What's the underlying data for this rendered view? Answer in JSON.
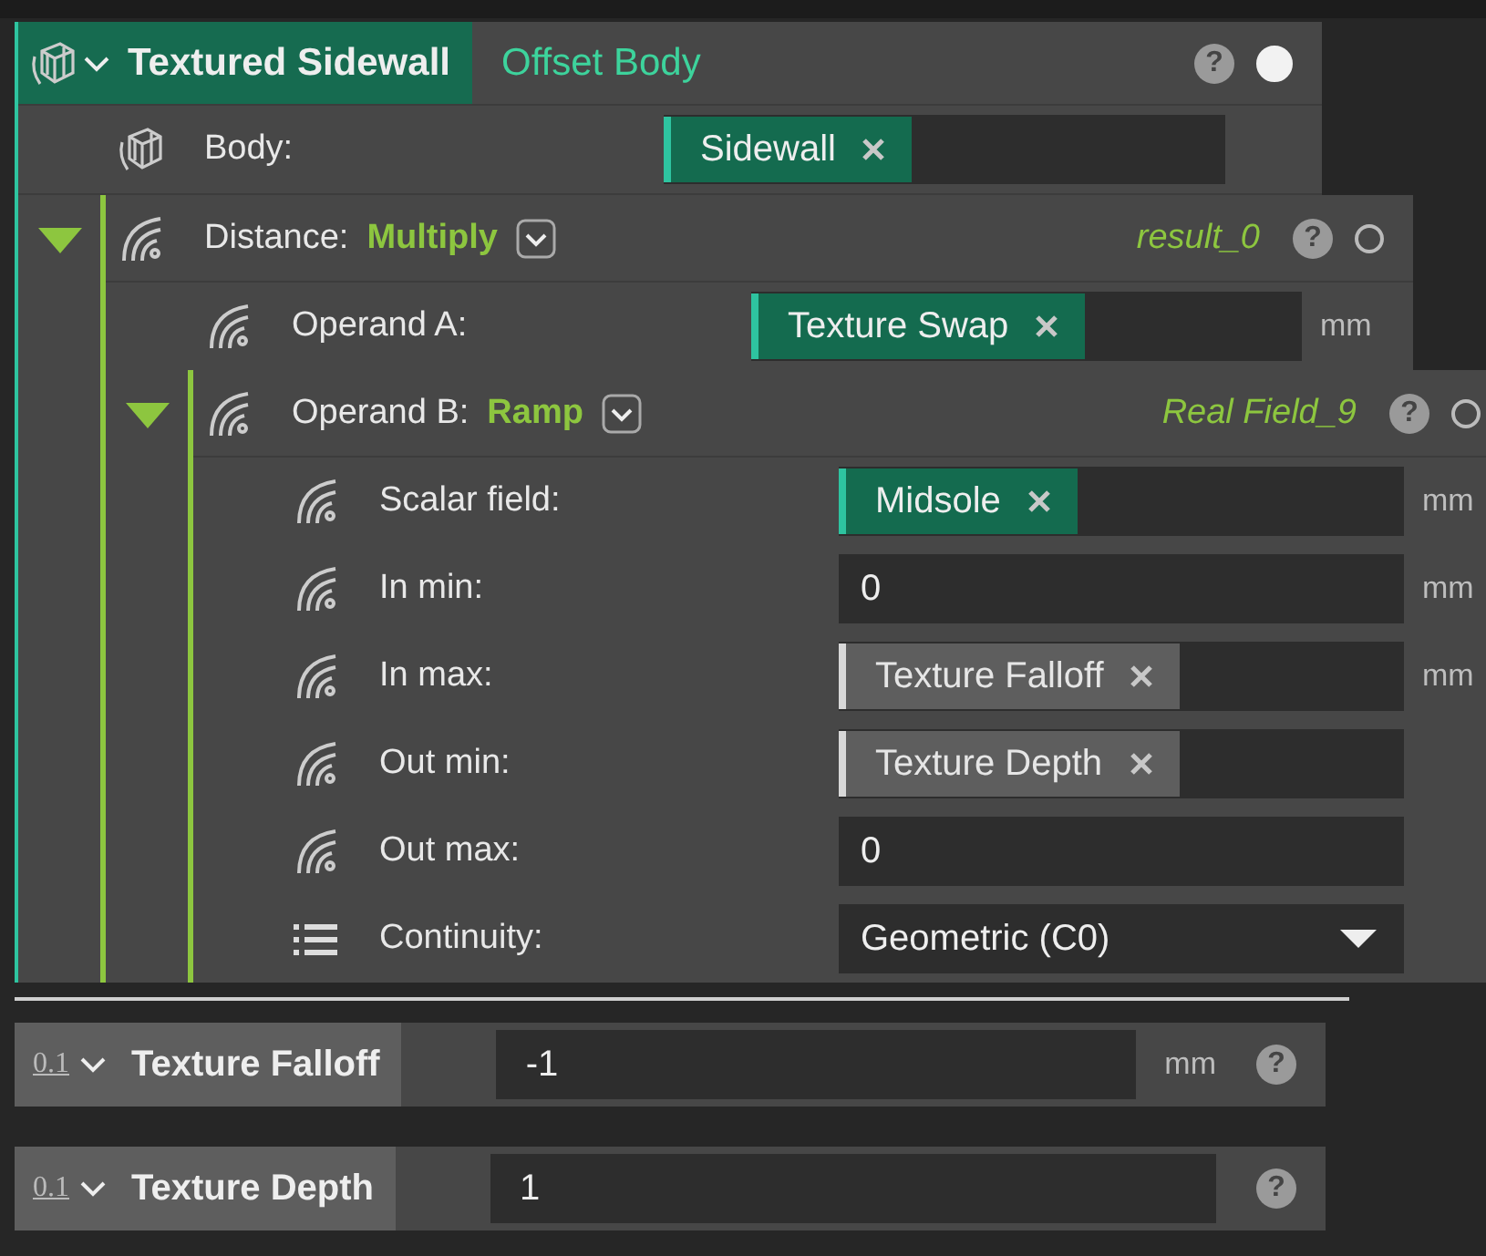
{
  "node": {
    "title": "Textured Sidewall",
    "type": "Offset Body",
    "help": "?",
    "exposed": true,
    "inputs": [
      {
        "label": "Body:",
        "kind": "chip",
        "chip": {
          "text": "Sidewall",
          "kind": "object"
        }
      }
    ]
  },
  "distance": {
    "label": "Distance:",
    "operator": "Multiply",
    "result": "result_0",
    "help": "?",
    "exposed": false,
    "expanded": true,
    "inputs": [
      {
        "label": "Operand A:",
        "kind": "chip",
        "chip": {
          "text": "Texture Swap",
          "kind": "object"
        },
        "unit": "mm"
      }
    ],
    "operand_b": {
      "label": "Operand B:",
      "operator": "Ramp",
      "result": "Real Field_9",
      "help": "?",
      "exposed": false,
      "expanded": true,
      "inputs": [
        {
          "label": "Scalar field:",
          "kind": "chip",
          "chip": {
            "text": "Midsole",
            "kind": "object"
          },
          "unit": "mm"
        },
        {
          "label": "In min:",
          "kind": "number",
          "value": "0",
          "unit": "mm"
        },
        {
          "label": "In max:",
          "kind": "chip",
          "chip": {
            "text": "Texture Falloff",
            "kind": "variable"
          },
          "unit": "mm"
        },
        {
          "label": "Out min:",
          "kind": "chip",
          "chip": {
            "text": "Texture Depth",
            "kind": "variable"
          }
        },
        {
          "label": "Out max:",
          "kind": "number",
          "value": "0"
        },
        {
          "label": "Continuity:",
          "kind": "dropdown",
          "value": "Geometric (C0)"
        }
      ]
    }
  },
  "parameters": [
    {
      "type_icon": "0.1",
      "label": "Texture Falloff",
      "value": "-1",
      "unit": "mm",
      "help": "?"
    },
    {
      "type_icon": "0.1",
      "label": "Texture Depth",
      "value": "1",
      "help": "?"
    }
  ]
}
